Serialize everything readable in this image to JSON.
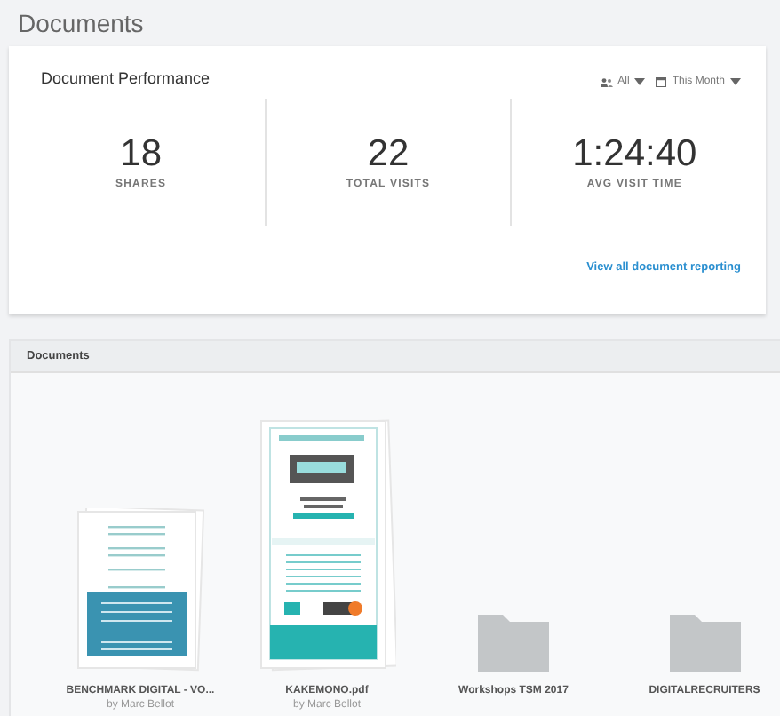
{
  "page_title": "Documents",
  "performance": {
    "title": "Document Performance",
    "filters": [
      {
        "kind": "people",
        "label": "All"
      },
      {
        "kind": "calendar",
        "label": "This Month"
      }
    ],
    "stats": [
      {
        "value": "18",
        "label": "SHARES"
      },
      {
        "value": "22",
        "label": "TOTAL VISITS"
      },
      {
        "value": "1:24:40",
        "label": "AVG VISIT TIME"
      }
    ],
    "link": "View all document reporting"
  },
  "documents": {
    "title": "Documents",
    "items": [
      {
        "kind": "brochure",
        "name": "BENCHMARK DIGITAL - VO...",
        "author": "by Marc Bellot"
      },
      {
        "kind": "poster",
        "name": "KAKEMONO.pdf",
        "author": "by Marc Bellot"
      },
      {
        "kind": "folder",
        "name": "Workshops TSM 2017"
      },
      {
        "kind": "folder",
        "name": "DIGITALRECRUITERS"
      }
    ]
  }
}
